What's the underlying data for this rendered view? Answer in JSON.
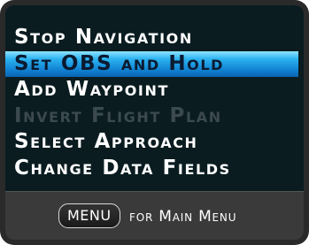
{
  "menu": {
    "items": [
      {
        "label": "Stop Navigation",
        "state": "normal"
      },
      {
        "label": "Set OBS and Hold",
        "state": "selected"
      },
      {
        "label": "Add Waypoint",
        "state": "normal"
      },
      {
        "label": "Invert Flight Plan",
        "state": "disabled"
      },
      {
        "label": "Select Approach",
        "state": "normal"
      },
      {
        "label": "Change Data Fields",
        "state": "normal"
      }
    ]
  },
  "footer": {
    "key_label": "MENU",
    "hint_text": "for Main Menu"
  },
  "colors": {
    "menu_background": "#0a1c20",
    "highlight": "#2bb3f0",
    "enabled_text": "#ffffff",
    "disabled_text": "#3c4a4f",
    "footer_background": "#3a3a3a"
  }
}
